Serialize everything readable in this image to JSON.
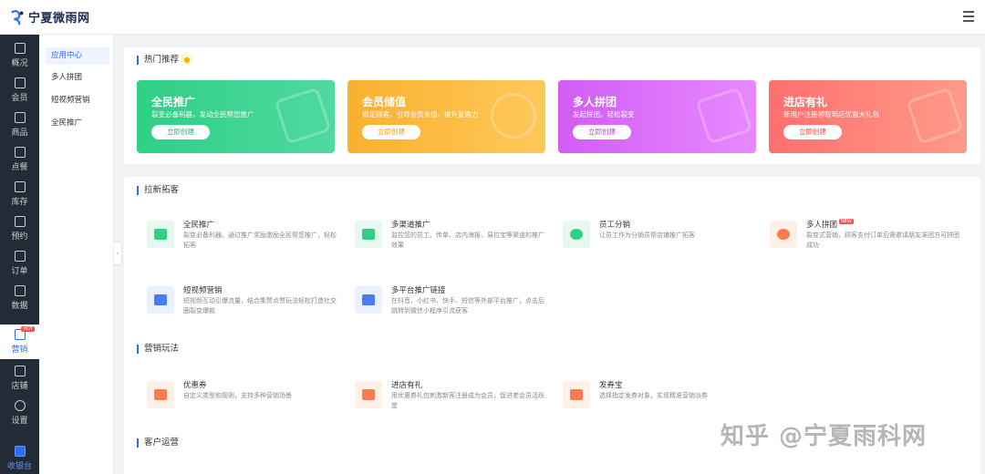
{
  "app": {
    "logo_text": "宁夏微雨网"
  },
  "sidebar": {
    "items": [
      {
        "label": "概况",
        "icon": "grid-icon"
      },
      {
        "label": "会员",
        "icon": "crown-icon"
      },
      {
        "label": "商品",
        "icon": "shop-icon"
      },
      {
        "label": "点餐",
        "icon": "food-icon"
      },
      {
        "label": "库存",
        "icon": "inventory-icon"
      },
      {
        "label": "预约",
        "icon": "calendar-icon"
      },
      {
        "label": "订单",
        "icon": "order-icon"
      },
      {
        "label": "数据",
        "icon": "chart-icon"
      },
      {
        "label": "营销",
        "icon": "marketing-icon",
        "badge": "HOT",
        "active": true
      },
      {
        "label": "店铺",
        "icon": "store-icon"
      },
      {
        "label": "设置",
        "icon": "settings-icon"
      },
      {
        "label": "收银台",
        "icon": "cashier-icon"
      }
    ]
  },
  "subnav": {
    "items": [
      {
        "label": "应用中心",
        "active": true
      },
      {
        "label": "多人拼团"
      },
      {
        "label": "短视频营销"
      },
      {
        "label": "全民推广"
      }
    ]
  },
  "hot": {
    "title": "热门推荐",
    "cards": [
      {
        "title": "全民推广",
        "subtitle": "裂变必备利器，发动全民帮您推广",
        "button": "立即创建",
        "color": "#2fcf86"
      },
      {
        "title": "会员储值",
        "subtitle": "锁定顾客，引导会员充值，提升复购力",
        "button": "立即创建",
        "color": "#f9b12f"
      },
      {
        "title": "多人拼团",
        "subtitle": "发起拼团，轻松裂变",
        "button": "立即创建",
        "color": "#d15cf5"
      },
      {
        "title": "进店有礼",
        "subtitle": "新用户注册领取到店优惠大礼包",
        "button": "立即创建",
        "color": "#ff6f6f"
      }
    ]
  },
  "sections": {
    "acquire": {
      "title": "拉新拓客",
      "items": [
        {
          "name": "全民推广",
          "desc": "裂变必备利器。通过推广奖励激励全民帮您推广，轻松拓客",
          "icon": "megaphone-icon",
          "color": "#2fcf86"
        },
        {
          "name": "多渠道推广",
          "desc": "监控您的员工、传单、店内海报、易拉宝等渠道的推广效果",
          "icon": "channel-icon",
          "color": "#2fcf86"
        },
        {
          "name": "员工分销",
          "desc": "让员工作为分销员帮店铺推广拓客",
          "icon": "distribution-icon",
          "color": "#2fcf86"
        },
        {
          "name": "多人拼团",
          "badge": "NEW",
          "desc": "裂变式营销，顾客支付订单后需邀请朋友凑团方可拼团成功",
          "icon": "group-buy-icon",
          "color": "#ff7a50"
        },
        {
          "name": "短视频营销",
          "desc": "短视频互动引爆流量，结合集赞点赞玩法轻松打造社交圈裂变爆款",
          "icon": "video-icon",
          "color": "#4a7cf7"
        },
        {
          "name": "多平台推广链接",
          "desc": "在抖音、小红书、快手、短信等外部平台推广，点击后跳转到微信小程序引流获客",
          "icon": "link-icon",
          "color": "#4a7cf7"
        }
      ]
    },
    "marketing": {
      "title": "营销玩法",
      "items": [
        {
          "name": "优惠券",
          "desc": "自定义类型和规则，支持多种营销场景",
          "icon": "coupon-icon",
          "color": "#ff7a50"
        },
        {
          "name": "进店有礼",
          "desc": "用优惠券礼包刺激新客注册成为会员，促进老会员活跃度",
          "icon": "gift-store-icon",
          "color": "#ff7a50"
        },
        {
          "name": "发券宝",
          "desc": "选择指定发券对象，实现精准营销派券",
          "icon": "coupon-send-icon",
          "color": "#ff7a50"
        }
      ]
    },
    "customer": {
      "title": "客户运营"
    }
  },
  "watermark": "知乎 @宁夏雨科网"
}
